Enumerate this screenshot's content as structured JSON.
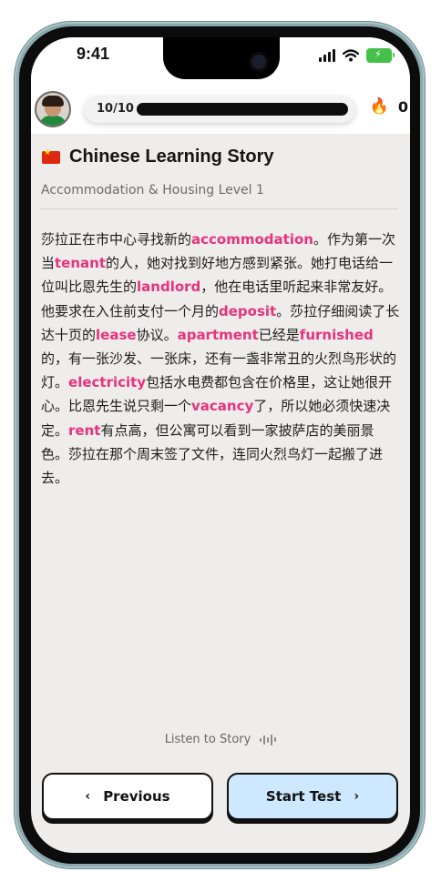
{
  "status_bar": {
    "time": "9:41"
  },
  "header": {
    "progress_text": "10/10",
    "progress_fraction": 1.0,
    "streak_count": "0",
    "icons": {
      "avatar": "user-avatar",
      "streak": "fire-icon"
    }
  },
  "story": {
    "flag": "china-flag-icon",
    "title": "Chinese Learning Story",
    "subtitle": "Accommodation & Housing Level 1",
    "segments": [
      {
        "t": "莎拉正在市中心寻找新的"
      },
      {
        "t": "accommodation",
        "kw": true
      },
      {
        "t": "。作为第一次当"
      },
      {
        "t": "tenant",
        "kw": true
      },
      {
        "t": "的人，她对找到好地方感到紧张。她打电话给一位叫比恩先生的"
      },
      {
        "t": "landlord",
        "kw": true
      },
      {
        "t": "，他在电话里听起来非常友好。他要求在入住前支付一个月的"
      },
      {
        "t": "deposit",
        "kw": true
      },
      {
        "t": "。莎拉仔细阅读了长达十页的"
      },
      {
        "t": "lease",
        "kw": true
      },
      {
        "t": "协议。"
      },
      {
        "t": "apartment",
        "kw": true
      },
      {
        "t": "已经是"
      },
      {
        "t": "furnished",
        "kw": true
      },
      {
        "t": "的，有一张沙发、一张床，还有一盏非常丑的火烈鸟形状的灯。"
      },
      {
        "t": "electricity",
        "kw": true
      },
      {
        "t": "包括水电费都包含在价格里，这让她很开心。比恩先生说只剩一个"
      },
      {
        "t": "vacancy",
        "kw": true
      },
      {
        "t": "了，所以她必须快速决定。"
      },
      {
        "t": "rent",
        "kw": true
      },
      {
        "t": "有点高，但公寓可以看到一家披萨店的美丽景色。莎拉在那个周末签了文件，连同火烈鸟灯一起搬了进去。"
      }
    ],
    "keyword_color": "#e8327d"
  },
  "listen_label": "Listen to Story",
  "buttons": {
    "previous": "Previous",
    "start_test": "Start Test"
  },
  "colors": {
    "background": "#efedeb",
    "start_test_bg": "#cde8ff"
  }
}
